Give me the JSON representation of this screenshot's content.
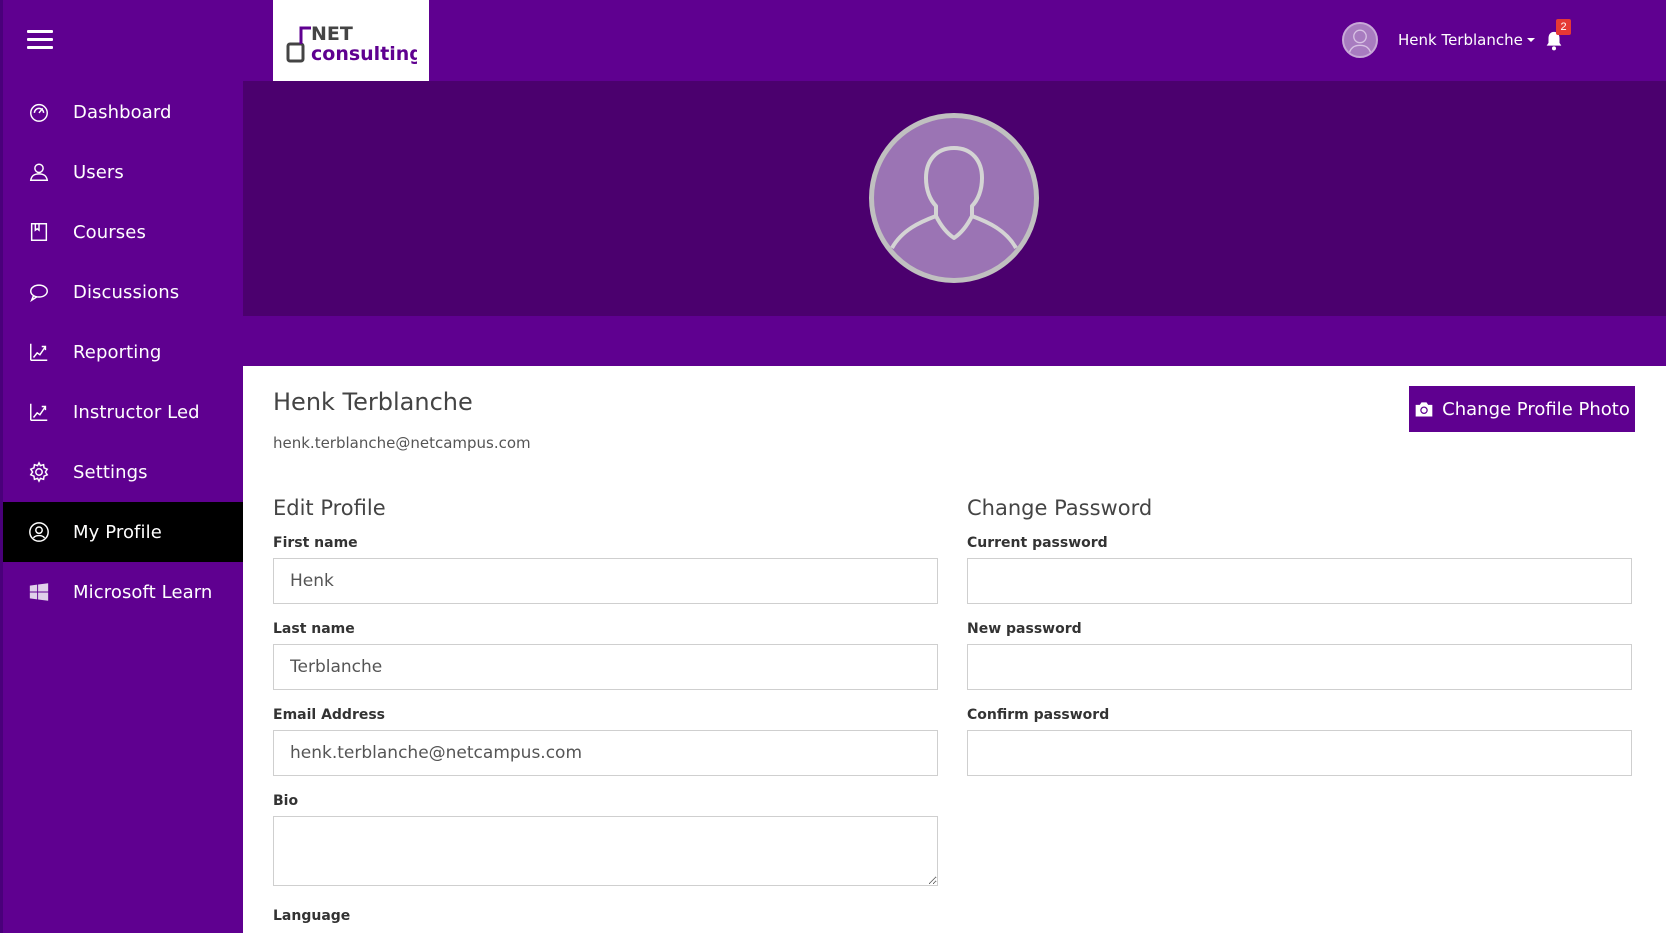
{
  "sidebar": {
    "items": [
      {
        "label": "Dashboard",
        "icon": "dashboard-icon"
      },
      {
        "label": "Users",
        "icon": "user-icon"
      },
      {
        "label": "Courses",
        "icon": "book-icon"
      },
      {
        "label": "Discussions",
        "icon": "chat-bubble-icon"
      },
      {
        "label": "Reporting",
        "icon": "chart-icon"
      },
      {
        "label": "Instructor Led",
        "icon": "chart-icon"
      },
      {
        "label": "Settings",
        "icon": "gear-icon"
      },
      {
        "label": "My Profile",
        "icon": "profile-icon",
        "active": true
      },
      {
        "label": "Microsoft Learn",
        "icon": "windows-icon"
      }
    ]
  },
  "header": {
    "logo_text_top": "NET",
    "logo_text_bottom": "consulting",
    "user_name": "Henk Terblanche",
    "notification_count": "2"
  },
  "profile": {
    "name": "Henk Terblanche",
    "email": "henk.terblanche@netcampus.com",
    "change_photo_label": "Change Profile Photo"
  },
  "edit_profile": {
    "title": "Edit Profile",
    "first_name_label": "First name",
    "first_name_value": "Henk",
    "last_name_label": "Last name",
    "last_name_value": "Terblanche",
    "email_label": "Email Address",
    "email_value": "henk.terblanche@netcampus.com",
    "bio_label": "Bio",
    "bio_value": "",
    "language_label": "Language"
  },
  "change_password": {
    "title": "Change Password",
    "current_label": "Current password",
    "new_label": "New password",
    "confirm_label": "Confirm password"
  },
  "colors": {
    "primary": "#5f0090",
    "banner": "#4b006e",
    "active_nav": "#000000",
    "badge": "#e53935"
  }
}
